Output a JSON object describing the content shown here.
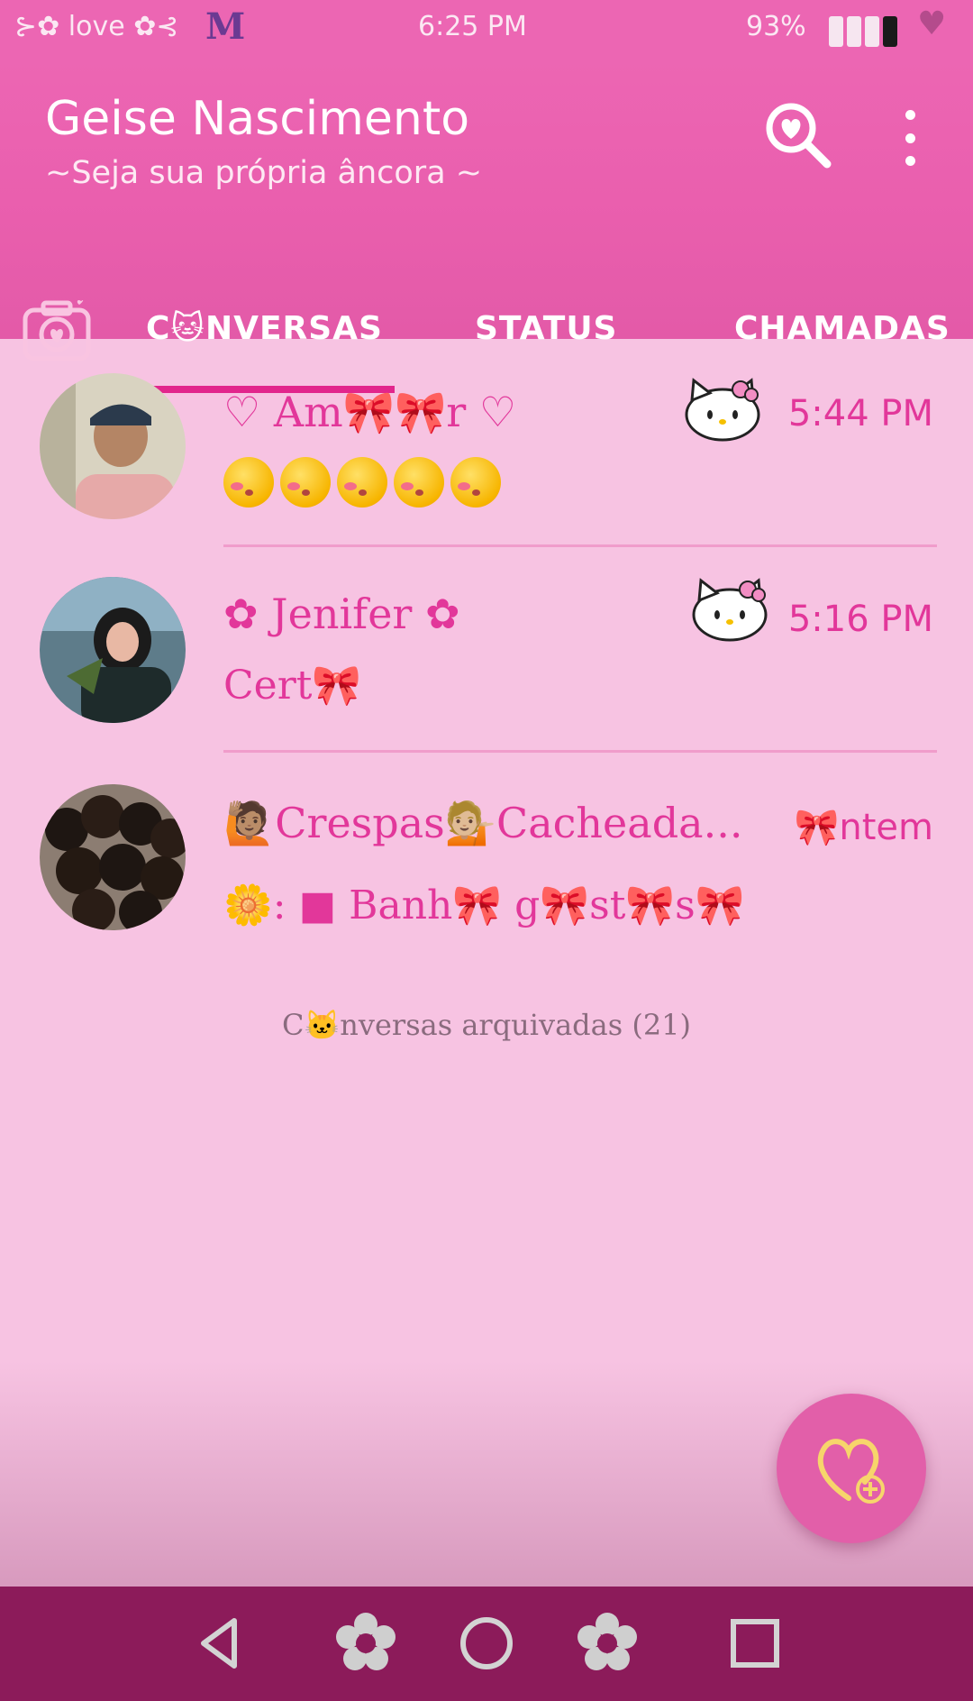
{
  "status_bar": {
    "left_text": "⊱✿ love ✿⊰",
    "logo_text": "M",
    "time": "6:25 PM",
    "battery_pct": "93%"
  },
  "header": {
    "title": "Geise Nascimento",
    "subtitle": "~Seja sua própria âncora ~"
  },
  "tabs": [
    {
      "label": "C🐱NVERSAS",
      "active": true
    },
    {
      "label": "STATUS",
      "active": false
    },
    {
      "label": "CHAMADAS",
      "active": false
    }
  ],
  "chats": [
    {
      "name": "♡ Am🎀🎀r ♡",
      "time": "5:44 PM",
      "preview": ""
    },
    {
      "name": "✿ Jenifer ✿",
      "time": "5:16 PM",
      "preview": "Cert🎀"
    },
    {
      "name": "🙋🏽Crespas💁🏼Cacheada...",
      "time": "🎀ntem",
      "preview": "🌼: ■ Banh🎀 g🎀st🎀s🎀"
    }
  ],
  "archived": "C🐱nversas arquivadas (21)",
  "colors": {
    "header": "#ec66b3",
    "accent": "#e2379a",
    "background": "#f7c3e2",
    "navbar": "#8c1b5a"
  },
  "icons": [
    "heart-search-icon",
    "more-vert-icon",
    "camera-heart-icon",
    "hello-kitty-icon",
    "heart-plus-icon",
    "back-icon",
    "flower-icon",
    "home-icon",
    "recents-icon"
  ]
}
